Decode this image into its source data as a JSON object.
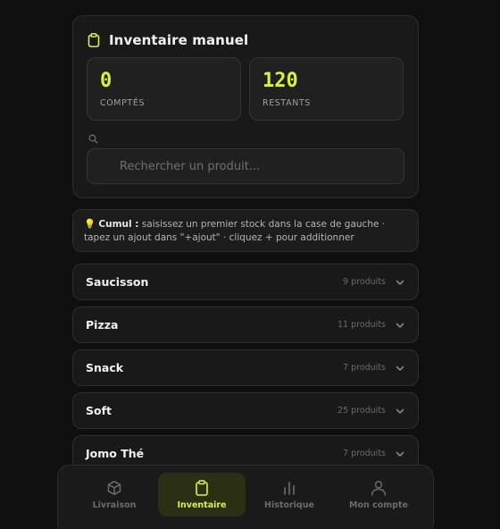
{
  "header": {
    "title": "Inventaire manuel",
    "icon": "clipboard-icon"
  },
  "stats": {
    "counted_value": "0",
    "counted_label": "COMPTÉS",
    "remaining_value": "120",
    "remaining_label": "RESTANTS"
  },
  "search": {
    "placeholder": "Rechercher un produit...",
    "value": ""
  },
  "tip": {
    "emoji": "💡",
    "label": "Cumul :",
    "text": " saisissez un premier stock dans la case de gauche · tapez un ajout dans \"+ajout\" · cliquez + pour additionner"
  },
  "categories": [
    {
      "name": "Saucisson",
      "count": "9 produits"
    },
    {
      "name": "Pizza",
      "count": "11 produits"
    },
    {
      "name": "Snack",
      "count": "7 produits"
    },
    {
      "name": "Soft",
      "count": "25 produits"
    },
    {
      "name": "Jomo Thé",
      "count": "7 produits"
    }
  ],
  "nav": {
    "items": [
      {
        "label": "Livraison",
        "icon": "box-icon"
      },
      {
        "label": "Inventaire",
        "icon": "clipboard-icon"
      },
      {
        "label": "Historique",
        "icon": "bar-chart-icon"
      },
      {
        "label": "Mon compte",
        "icon": "user-icon"
      }
    ],
    "active": "Inventaire"
  },
  "colors": {
    "accent": "#d7f33a",
    "background": "#0f0f0f",
    "card": "#191919"
  }
}
